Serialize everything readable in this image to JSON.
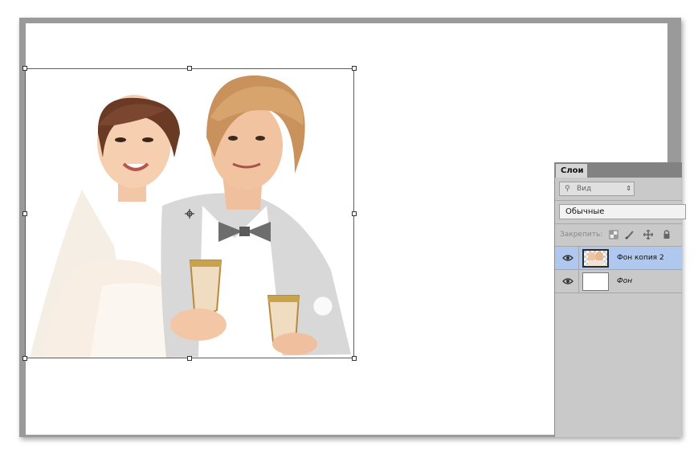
{
  "layers_panel": {
    "tab_label": "Слои",
    "kind_filter": {
      "icon": "search-icon",
      "placeholder": "Вид",
      "arrow": "⇕"
    },
    "blend_mode": "Обычные",
    "lock_label": "Закрепить:",
    "lock_icons": [
      "lock-transparent-pixels-icon",
      "lock-image-pixels-icon",
      "lock-position-icon",
      "lock-all-icon"
    ],
    "layers": [
      {
        "name": "Фон копия 2",
        "selected": true,
        "visible": true,
        "italic": false
      },
      {
        "name": "Фон",
        "selected": false,
        "visible": true,
        "italic": true
      }
    ]
  },
  "canvas": {
    "layer_content": "wedding-couple-photo",
    "transform_mode": "free-transform",
    "handles": 8
  },
  "colors": {
    "canvas_bg": "#ffffff",
    "workspace": "#9a9a9a",
    "panel_bg": "#c9c9c9",
    "selected_layer": "#b0c7ee"
  }
}
